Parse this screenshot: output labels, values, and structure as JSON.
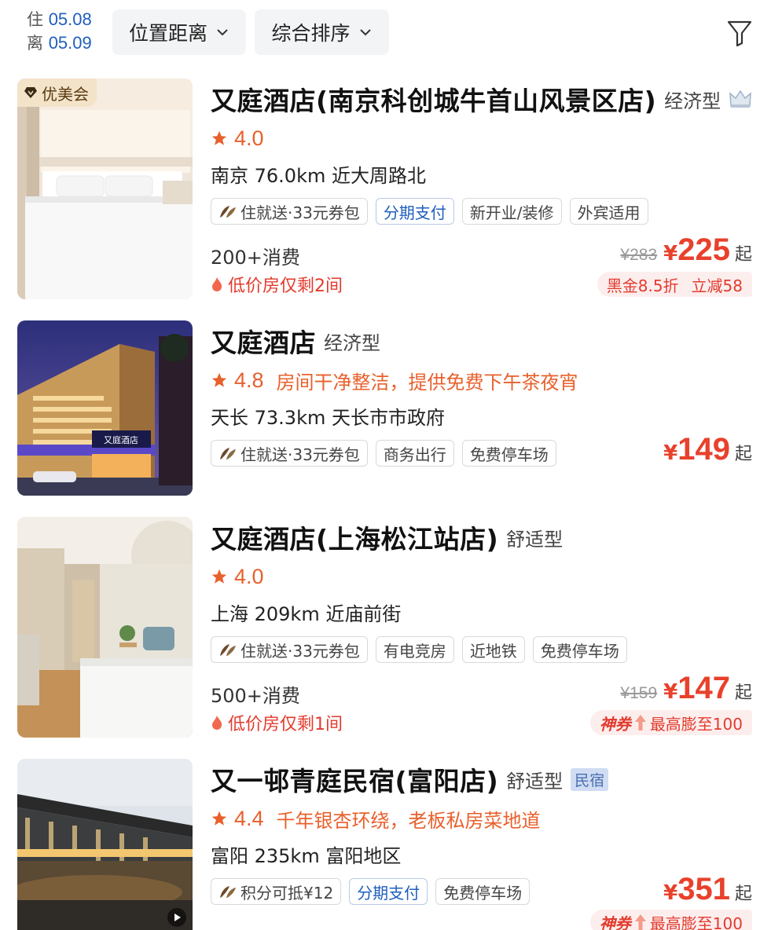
{
  "header": {
    "checkin_label": "住",
    "checkin_date": "05.08",
    "checkout_label": "离",
    "checkout_date": "05.09",
    "filters": [
      {
        "label": "位置距离"
      },
      {
        "label": "综合排序"
      }
    ],
    "filter_icon": "funnel-icon"
  },
  "colors": {
    "accent_orange": "#e8602c",
    "price_red": "#e8412c",
    "link_blue": "#1f5fbf"
  },
  "hotels": [
    {
      "badge": "优美会",
      "name": "又庭酒店(南京科创城牛首山风景区店)",
      "type": "经济型",
      "icon": "crown-icon",
      "rating": "4.0",
      "highlight": "",
      "location": "南京 76.0km  近大周路北",
      "tags": [
        "住就送·33元券包",
        "分期支付",
        "新开业/装修",
        "外宾适用"
      ],
      "consumption": "200+消费",
      "low_stock": "低价房仅剩2间",
      "original_price": "¥283",
      "currency": "¥",
      "price": "225",
      "price_suffix": "起",
      "promo_left": "黑金8.5折",
      "promo_right": "立减58"
    },
    {
      "name": "又庭酒店",
      "type": "经济型",
      "rating": "4.8",
      "highlight": "房间干净整洁，提供免费下午茶夜宵",
      "location": "天长 73.3km  天长市市政府",
      "tags": [
        "住就送·33元券包",
        "商务出行",
        "免费停车场"
      ],
      "currency": "¥",
      "price": "149",
      "price_suffix": "起",
      "sign_text": "又庭酒店"
    },
    {
      "name": "又庭酒店(上海松江站店)",
      "type": "舒适型",
      "rating": "4.0",
      "highlight": "",
      "location": "上海 209km  近庙前街",
      "tags": [
        "住就送·33元券包",
        "有电竞房",
        "近地铁",
        "免费停车场"
      ],
      "consumption": "500+消费",
      "low_stock": "低价房仅剩1间",
      "original_price": "¥159",
      "currency": "¥",
      "price": "147",
      "price_suffix": "起",
      "promo_brand": "神券",
      "promo_text": "最高膨至100"
    },
    {
      "name": "又一邨青庭民宿(富阳店)",
      "type": "舒适型",
      "category_badge": "民宿",
      "rating": "4.4",
      "highlight": "千年银杏环绕，老板私房菜地道",
      "location": "富阳 235km  富阳地区",
      "tags": [
        "积分可抵¥12",
        "分期支付",
        "免费停车场"
      ],
      "currency": "¥",
      "price": "351",
      "price_suffix": "起",
      "promo_brand": "神券",
      "promo_text": "最高膨至100"
    }
  ]
}
